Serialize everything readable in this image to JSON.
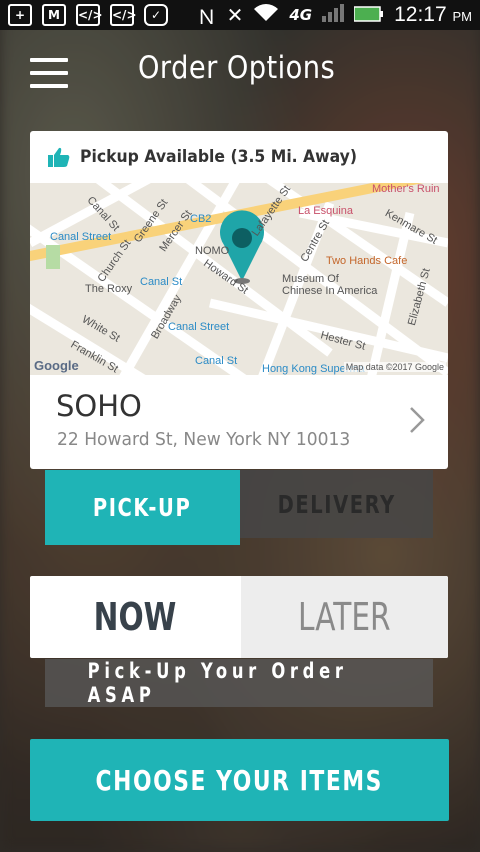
{
  "status_bar": {
    "time": "12:17",
    "ampm": "PM",
    "network": "4G"
  },
  "header": {
    "title": "Order Options"
  },
  "location_card": {
    "pickup_text": "Pickup Available (3.5 Mi. Away)",
    "name": "SOHO",
    "address": "22 Howard St, New York NY 10013",
    "map": {
      "labels": {
        "canal_street_1": "Canal Street",
        "canal_st": "Canal St",
        "greene_st": "Greene St",
        "mercer_st": "Mercer St",
        "church_st": "Church St",
        "the_roxy": "The Roxy",
        "cb2": "CB2",
        "nomo": "NOMO",
        "howard_st": "Howard St",
        "lafayette_st": "Lafayette St",
        "la_esquina": "La Esquina",
        "mothers_ruin": "Mother's Ruin",
        "kenmare_st": "Kenmare St",
        "centre_st": "Centre St",
        "two_hands_cafe": "Two Hands Cafe",
        "museum_1": "Museum Of",
        "museum_2": "Chinese In America",
        "elizabeth_st": "Elizabeth St",
        "white_st": "White St",
        "broadway": "Broadway",
        "canal_street_2": "Canal Street",
        "canal_st_2": "Canal St",
        "franklin_st": "Franklin St",
        "hester_st": "Hester St",
        "hong_kong": "Hong Kong Superma",
        "google": "Google",
        "map_data": "Map data ©2017 Google"
      }
    }
  },
  "order_type": {
    "pickup": "PICK-UP",
    "delivery": "DELIVERY"
  },
  "timing": {
    "now": "NOW",
    "later": "LATER",
    "hint": "Pick-Up Your Order ASAP"
  },
  "cta": {
    "label": "CHOOSE YOUR ITEMS"
  },
  "colors": {
    "accent": "#1fb4b6",
    "dark_text": "#38424b"
  }
}
